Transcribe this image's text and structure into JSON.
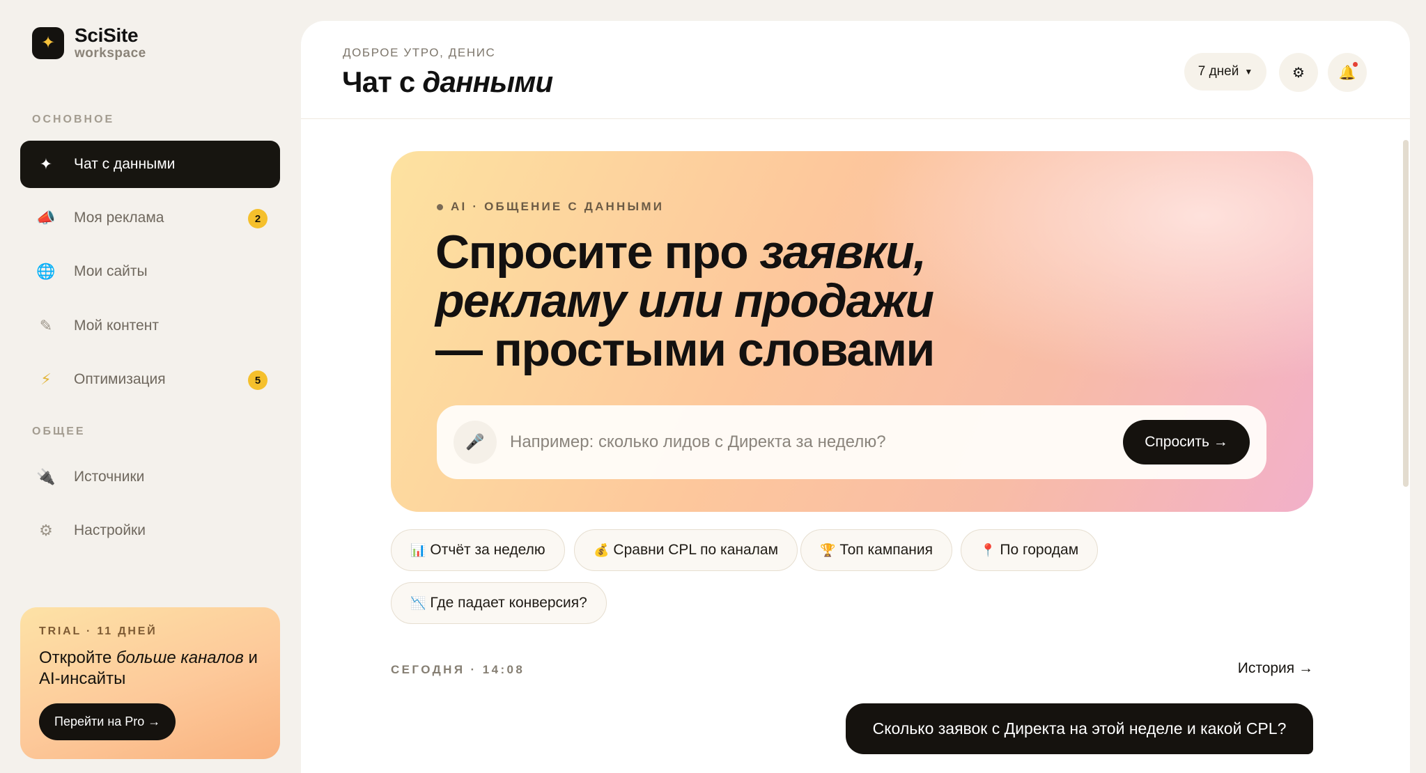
{
  "brand": {
    "logo_icon": "✦",
    "name": "SciSite",
    "sub": "workspace"
  },
  "sidebar": {
    "section_main": "ОСНОВНОЕ",
    "section_general": "ОБЩЕЕ",
    "items": [
      {
        "label": "Чат с данными",
        "icon": "sparkle-icon",
        "glyph": "✦",
        "active": true,
        "badge": null
      },
      {
        "label": "Моя реклама",
        "icon": "megaphone-icon",
        "glyph": "📣",
        "active": false,
        "badge": "2"
      },
      {
        "label": "Мои сайты",
        "icon": "globe-icon",
        "glyph": "🌐",
        "active": false,
        "badge": null
      },
      {
        "label": "Мой контент",
        "icon": "pencil-icon",
        "glyph": "✎",
        "active": false,
        "badge": null
      },
      {
        "label": "Оптимизация",
        "icon": "lightning-icon",
        "glyph": "⚡",
        "active": false,
        "badge": "5"
      },
      {
        "label": "Источники",
        "icon": "plug-icon",
        "glyph": "🔌",
        "active": false,
        "badge": null
      },
      {
        "label": "Настройки",
        "icon": "gear-icon",
        "glyph": "⚙",
        "active": false,
        "badge": null
      }
    ],
    "trial": {
      "tag": "TRIAL · 11 ДНЕЙ",
      "text_before": "Откройте ",
      "text_em": "больше каналов",
      "text_after": " и AI-инсайты",
      "button": "Перейти на Pro →"
    }
  },
  "header": {
    "greeting": "ДОБРОЕ УТРО, ДЕНИС",
    "title_plain": "Чат с ",
    "title_em": "данными",
    "period": "7 дней",
    "settings_glyph": "⚙",
    "bell_glyph": "🔔"
  },
  "hero": {
    "tag": "AI · ОБЩЕНИЕ С ДАННЫМИ",
    "line1_plain": "Спросите про ",
    "line1_em": "заявки,",
    "line2_em": "рекламу или продажи",
    "line3_plain": "— простыми словами",
    "mic_glyph": "🎤",
    "input_placeholder": "Например: сколько лидов с Директа за неделю?",
    "input_value": "",
    "ask_button": "Спросить →"
  },
  "chips": [
    {
      "emoji": "📊",
      "label": "Отчёт за неделю"
    },
    {
      "emoji": "💰",
      "label": "Сравни CPL по каналам"
    },
    {
      "emoji": "🏆",
      "label": "Топ кампания"
    },
    {
      "emoji": "📍",
      "label": "По городам"
    },
    {
      "emoji": "📉",
      "label": "Где падает конверсия?"
    }
  ],
  "chat": {
    "date_label": "СЕГОДНЯ · 14:08",
    "history_link": "История →",
    "user_message": "Сколько заявок с Директа на этой неделе и какой CPL?"
  },
  "colors": {
    "accent_dark": "#15120e",
    "badge_yellow": "#f5c02c",
    "background": "#f4f1ec"
  }
}
